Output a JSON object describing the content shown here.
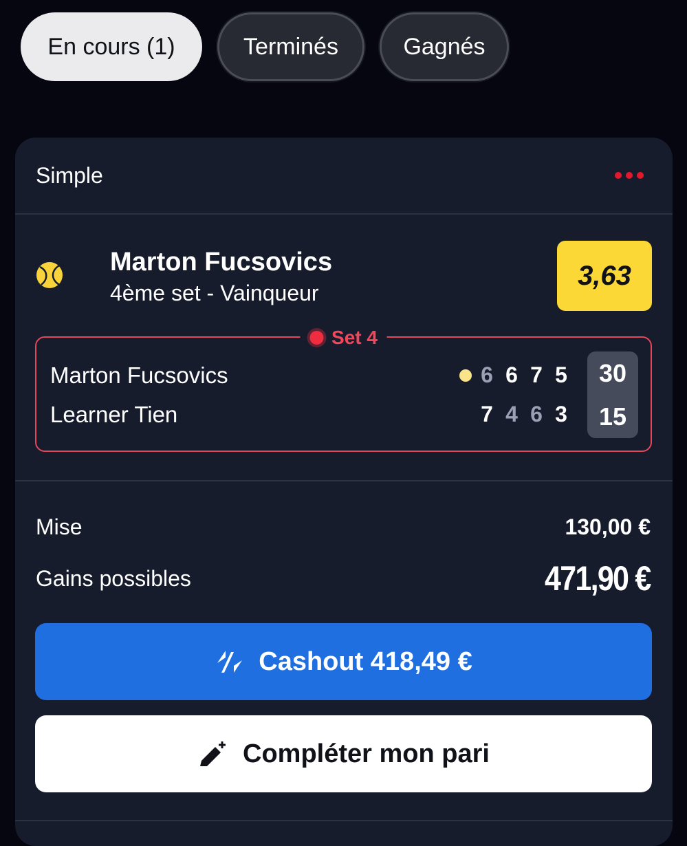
{
  "tabs": [
    {
      "label": "En cours (1)",
      "active": true
    },
    {
      "label": "Terminés",
      "active": false
    },
    {
      "label": "Gagnés",
      "active": false
    }
  ],
  "bet": {
    "type": "Simple",
    "more_icon": "more-dots-icon",
    "selection": {
      "name": "Marton Fucsovics",
      "market": "4ème set - Vainqueur",
      "odds": "3,63",
      "sport_icon": "tennis-ball-icon"
    },
    "live": {
      "label": "Set 4",
      "players": [
        {
          "name": "Marton Fucsovics",
          "serving": true,
          "sets": [
            "6",
            "6",
            "7",
            "5"
          ],
          "points": "30"
        },
        {
          "name": "Learner Tien",
          "serving": false,
          "sets": [
            "7",
            "4",
            "6",
            "3"
          ],
          "points": "15"
        }
      ]
    },
    "stake_label": "Mise",
    "stake_value": "130,00 €",
    "gains_label": "Gains possibles",
    "gains_value": "471,90 €",
    "cashout_label": "Cashout 418,49 €",
    "complete_label": "Compléter mon pari"
  },
  "colors": {
    "background": "#05060f",
    "card": "#171c2d",
    "odds_badge": "#fbd835",
    "live_red": "#ef2d3e",
    "cashout_blue": "#1f6fe0"
  }
}
